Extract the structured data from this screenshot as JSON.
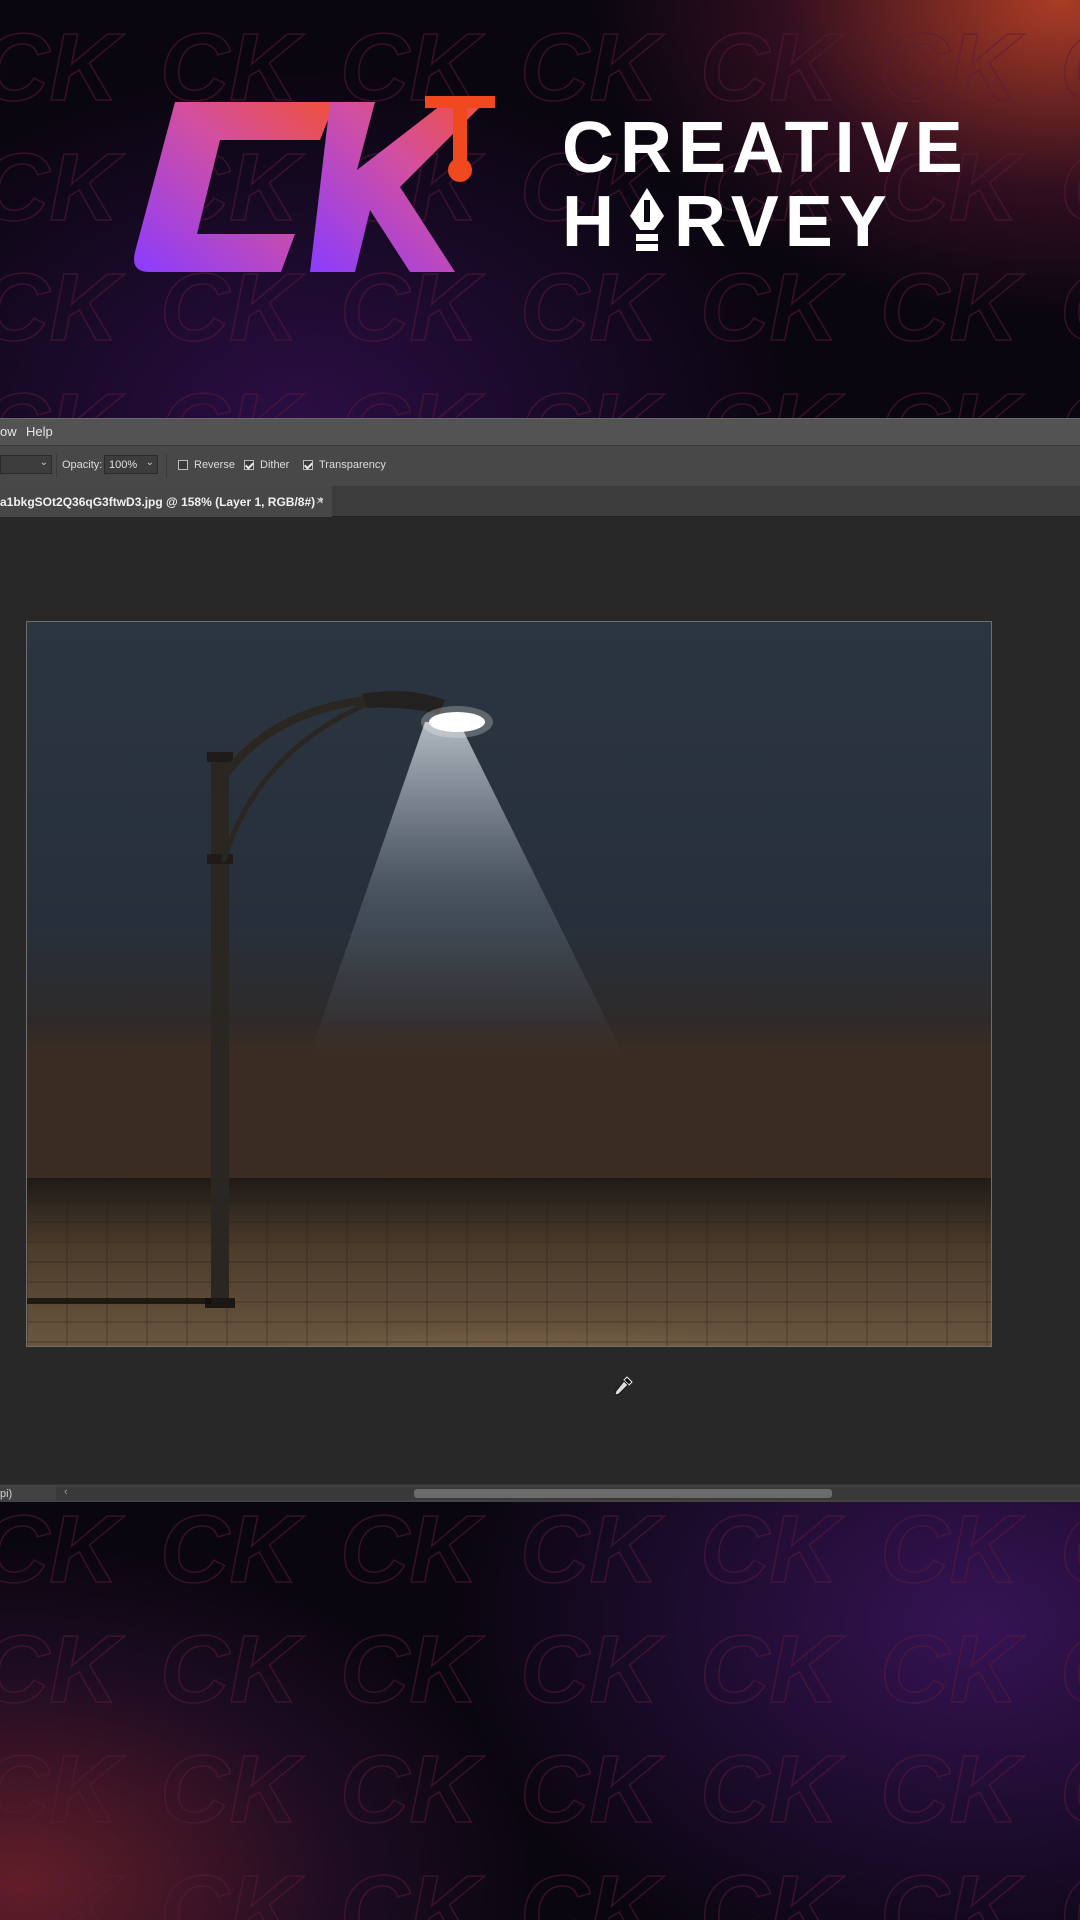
{
  "brand": {
    "monogram": "CK",
    "line1": "CREATIVE",
    "line2_prefix": "H",
    "line2_suffix": "RVEY",
    "pen_mark": "pen-nib-icon"
  },
  "menu": {
    "partial": "ow",
    "help": "Help"
  },
  "options": {
    "preset_value": "",
    "opacity_label": "Opacity:",
    "opacity_value": "100%",
    "reverse_label": "Reverse",
    "reverse_checked": false,
    "dither_label": "Dither",
    "dither_checked": true,
    "transparency_label": "Transparency",
    "transparency_checked": true
  },
  "document": {
    "tab_title": "a1bkgSOt2Q36qG3ftwD3.jpg @ 158% (Layer 1, RGB/8#) *",
    "close_glyph": "×"
  },
  "status": {
    "text": "pi)",
    "scroll_left_glyph": "‹"
  },
  "tool_cursor": "eyedropper-icon",
  "colors": {
    "brand_gradient_start": "#8a3cff",
    "brand_gradient_end": "#f0503a",
    "pen_orange": "#f0481f",
    "ui_menubar": "#535353",
    "ui_options": "#484848",
    "ui_canvas": "#282828"
  }
}
